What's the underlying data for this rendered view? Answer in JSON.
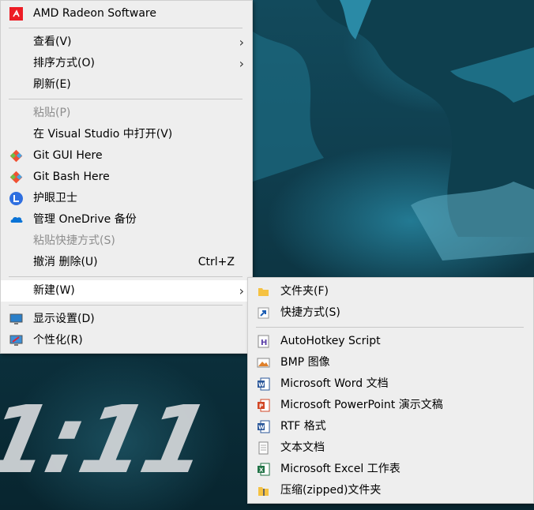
{
  "main_menu": {
    "amd": "AMD Radeon Software",
    "view": "查看(V)",
    "sort": "排序方式(O)",
    "refresh": "刷新(E)",
    "paste": "粘贴(P)",
    "open_vs": "在 Visual Studio 中打开(V)",
    "git_gui": "Git GUI Here",
    "git_bash": "Git Bash Here",
    "eye_guard": "护眼卫士",
    "onedrive": "管理 OneDrive 备份",
    "paste_shortcut": "粘贴快捷方式(S)",
    "undo_delete": "撤消 删除(U)",
    "undo_shortcut": "Ctrl+Z",
    "new": "新建(W)",
    "display": "显示设置(D)",
    "personalize": "个性化(R)"
  },
  "new_submenu": {
    "folder": "文件夹(F)",
    "shortcut": "快捷方式(S)",
    "ahk": "AutoHotkey Script",
    "bmp": "BMP 图像",
    "word": "Microsoft Word 文档",
    "ppt": "Microsoft PowerPoint 演示文稿",
    "rtf": "RTF 格式",
    "txt": "文本文档",
    "excel": "Microsoft Excel 工作表",
    "zip": "压缩(zipped)文件夹"
  },
  "desktop": {
    "clock_text": "1:11"
  },
  "colors": {
    "amd_red": "#ed1c24",
    "word_blue": "#2b579a",
    "ppt_orange": "#d24726",
    "excel_green": "#217346"
  }
}
